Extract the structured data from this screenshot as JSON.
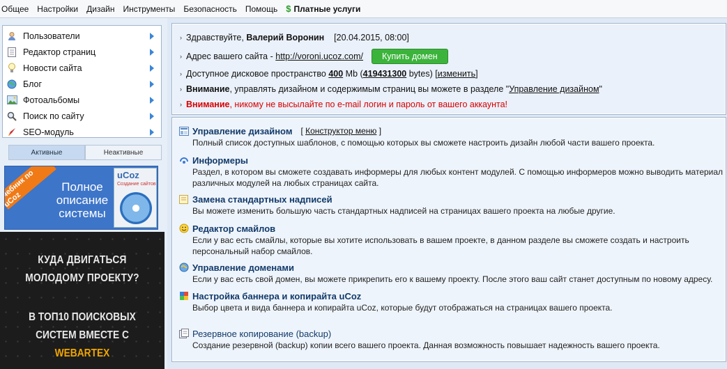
{
  "menubar": {
    "items": [
      "Общее",
      "Настройки",
      "Дизайн",
      "Инструменты",
      "Безопасность",
      "Помощь"
    ],
    "paid_label": "Платные услуги"
  },
  "sidebar": {
    "items": [
      {
        "label": "Пользователи",
        "icon": "user-icon"
      },
      {
        "label": "Редактор страниц",
        "icon": "page-icon"
      },
      {
        "label": "Новости сайта",
        "icon": "lightbulb-icon"
      },
      {
        "label": "Блог",
        "icon": "globe-icon"
      },
      {
        "label": "Фотоальбомы",
        "icon": "photo-icon"
      },
      {
        "label": "Поиск по сайту",
        "icon": "search-icon"
      },
      {
        "label": "SEO-модуль",
        "icon": "rocket-icon"
      }
    ],
    "tabs": {
      "active": "Активные",
      "inactive": "Неактивные"
    },
    "banner1": {
      "ribbon": "Учебник по uCoz",
      "text": "Полное описание системы",
      "book_title": "uCoz",
      "book_sub": "Создание сайтов"
    },
    "banner2": {
      "line1": "КУДА ДВИГАТЬСЯ",
      "line2": "МОЛОДОМУ ПРОЕКТУ?",
      "line3": "В ТОП10 ПОИСКОВЫХ",
      "line4a": "СИСТЕМ ВМЕСТЕ С ",
      "line4b": "WEBARTEX"
    }
  },
  "top_panel": {
    "greeting_prefix": "Здравствуйте,",
    "user_name": "Валерий Воронин",
    "datetime": "[20.04.2015, 08:00]",
    "site_label": "Адрес вашего сайта -",
    "site_url": "http://voroni.ucoz.com/",
    "buy_button": "Купить домен",
    "disk_label": "Доступное дисковое пространство",
    "disk_mb": "400",
    "disk_mb_unit": "Mb",
    "disk_bytes": "419431300",
    "disk_bytes_unit": "bytes)",
    "change_link": "изменить",
    "notice1_bold": "Внимание",
    "notice1_text": ", управлять дизайном и содержимым страниц вы можете в разделе \"",
    "notice1_link": "Управление дизайном",
    "notice2_bold": "Внимание",
    "notice2_text": ", никому не высылайте по e-mail логин и пароль от вашего аккаунта!"
  },
  "sections": [
    {
      "title": "Управление дизайном",
      "extra": "Конструктор меню",
      "desc": [
        "Полный список доступных шаблонов, с помощью которых вы сможете настроить дизайн любой части вашего проекта."
      ],
      "icon": "layout-icon"
    },
    {
      "title": "Информеры",
      "desc": [
        "Раздел, в котором вы сможете создавать информеры для любых контент модулей. С помощью информеров можно выводить материал",
        "различных модулей на любых страницах сайта."
      ],
      "icon": "informer-icon"
    },
    {
      "title": "Замена стандартных надписей",
      "desc": [
        "Вы можете изменить большую часть стандартных надписей на страницах вашего проекта на любые другие."
      ],
      "icon": "note-icon"
    },
    {
      "title": "Редактор смайлов",
      "desc": [
        "Если у вас есть смайлы, которые вы хотите использовать в вашем проекте, в данном разделе вы сможете создать и настроить",
        "персональный набор смайлов."
      ],
      "icon": "smiley-icon"
    },
    {
      "title": "Управление доменами",
      "desc": [
        "Если у вас есть свой домен, вы можете прикрепить его к вашему проекту. После этого ваш сайт станет доступным по новому адресу."
      ],
      "icon": "domain-icon"
    },
    {
      "title": "Настройка баннера и копирайта uCoz",
      "desc": [
        "Выбор цвета и вида баннера и копирайта uCoz, которые будут отображаться на страницах вашего проекта."
      ],
      "icon": "banner-icon"
    },
    {
      "title": "Резервное копирование (backup)",
      "desc": [
        "Создание резервной (backup) копии всего вашего проекта. Данная возможность повышает надежность вашего проекта."
      ],
      "icon": "backup-icon"
    }
  ]
}
